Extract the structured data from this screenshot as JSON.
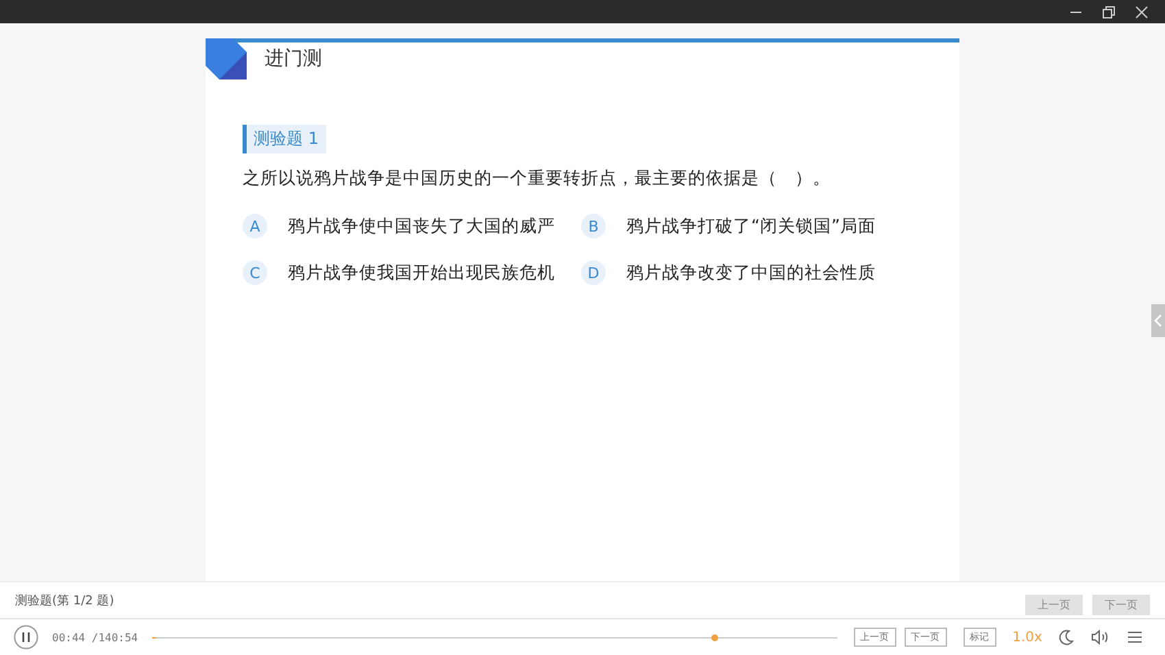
{
  "lesson": {
    "title": "进门测"
  },
  "question": {
    "tag": "测验题 1",
    "text": "之所以说鸦片战争是中国历史的一个重要转折点，最主要的依据是（　）。",
    "options": [
      {
        "letter": "A",
        "text": "鸦片战争使中国丧失了大国的威严"
      },
      {
        "letter": "B",
        "text": "鸦片战争打破了“闭关锁国”局面"
      },
      {
        "letter": "C",
        "text": "鸦片战争使我国开始出现民族危机"
      },
      {
        "letter": "D",
        "text": "鸦片战争改变了中国的社会性质"
      }
    ]
  },
  "question_bar": {
    "status": "测验题(第 1/2 题)",
    "buttons": [
      {
        "label": "上一页",
        "disabled": true
      },
      {
        "label": "下一页",
        "disabled": true
      }
    ]
  },
  "player": {
    "time": "00:44 /140:54",
    "progress": {
      "level": 0.006
    },
    "marker": {
      "level": 0.82
    },
    "buttons": [
      "上一页",
      "下一页",
      "标记"
    ],
    "speed": "1.0x"
  }
}
